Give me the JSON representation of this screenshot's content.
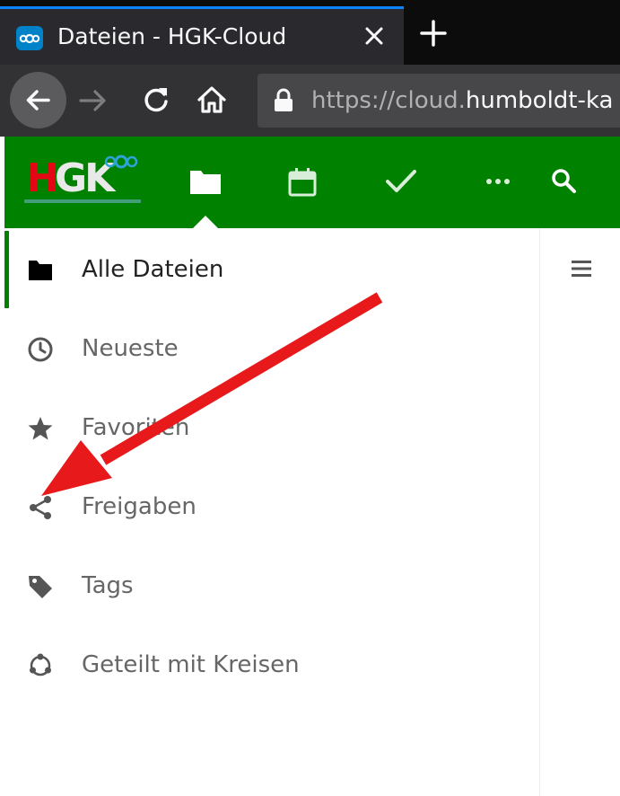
{
  "browser": {
    "tab_title": "Dateien - HGK-Cloud",
    "url_prefix": "https://cloud.",
    "url_domain": "humboldt-ka"
  },
  "header": {
    "logo_text_h": "H",
    "logo_text_gk": "GK",
    "apps": [
      {
        "name": "files",
        "icon": "folder-icon",
        "active": true
      },
      {
        "name": "calendar",
        "icon": "calendar-icon"
      },
      {
        "name": "tasks",
        "icon": "checkmark-icon"
      },
      {
        "name": "more",
        "icon": "more-icon"
      },
      {
        "name": "search",
        "icon": "search-icon"
      }
    ]
  },
  "sidebar": {
    "items": [
      {
        "label": "Alle Dateien",
        "icon": "folder-icon",
        "active": true
      },
      {
        "label": "Neueste",
        "icon": "clock-icon"
      },
      {
        "label": "Favoriten",
        "icon": "star-icon"
      },
      {
        "label": "Freigaben",
        "icon": "share-icon"
      },
      {
        "label": "Tags",
        "icon": "tag-icon"
      },
      {
        "label": "Geteilt mit Kreisen",
        "icon": "circles-icon"
      }
    ]
  },
  "colors": {
    "header_bg": "#008100",
    "accent_tab": "#0a84ff",
    "annotation_arrow": "#e8191b"
  }
}
